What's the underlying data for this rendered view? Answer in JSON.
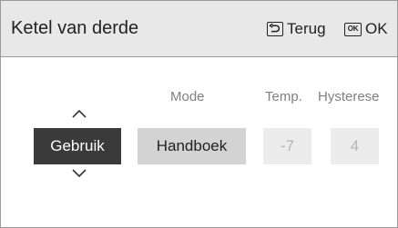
{
  "header": {
    "title": "Ketel van derde",
    "back_label": "Terug",
    "back_icon": "return-arrow-icon",
    "ok_key_text": "OK",
    "ok_label": "OK"
  },
  "columns": {
    "mode_label": "Mode",
    "temp_label": "Temp.",
    "hysteresis_label": "Hysterese"
  },
  "fields": {
    "usage_value": "Gebruik",
    "mode_value": "Handboek",
    "temp_value": "-7",
    "hysteresis_value": "4"
  },
  "colors": {
    "header_bg": "#e8e8e8",
    "selected_bg": "#3a3a3a",
    "value_bg": "#d3d3d3",
    "disabled_bg": "#ececec",
    "disabled_text": "#b5b5b5",
    "label_text": "#808080"
  }
}
